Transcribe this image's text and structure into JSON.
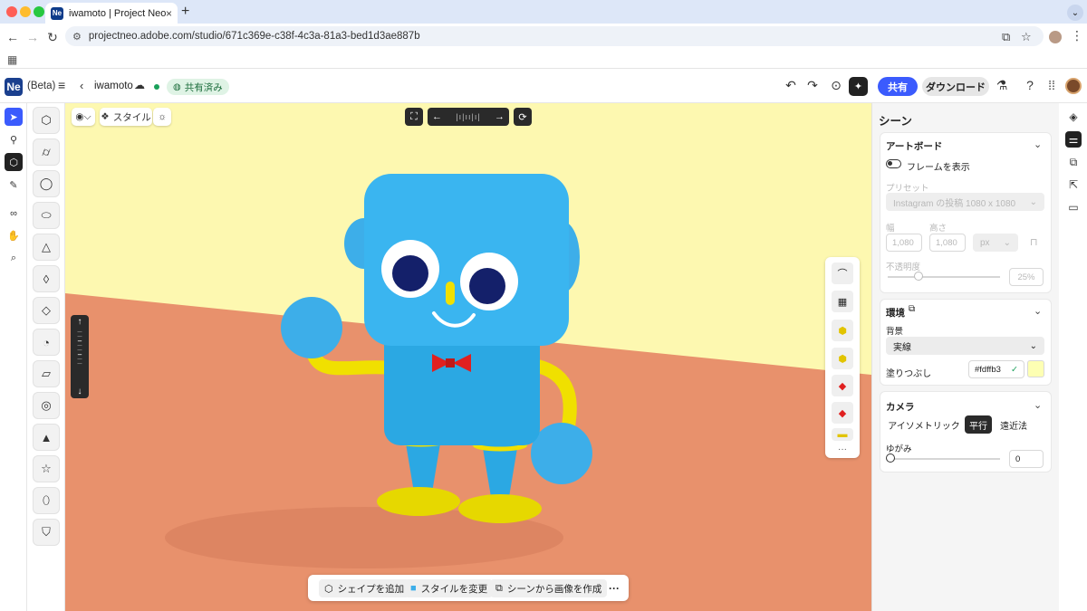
{
  "browser": {
    "tab_title": "iwamoto | Project Neo (Beta)",
    "tab_favicon": "Ne",
    "tab_close": "×",
    "new_tab": "+",
    "url": "projectneo.adobe.com/studio/671c369e-c38f-4c3a-81a3-bed1d3ae887b",
    "traffic_colors": [
      "#ff5f57",
      "#febc2e",
      "#28c840"
    ]
  },
  "app": {
    "logo": "Ne",
    "beta": "(Beta)",
    "doc_name": "iwamoto",
    "shared_label": "共有済み",
    "share_button": "共有",
    "download_button": "ダウンロード",
    "accent": "#3b5bfd"
  },
  "canvas": {
    "camera_chip": "⌵",
    "style_chip": "スタイル",
    "bottom_toolbar": {
      "add_shape": "シェイプを追加",
      "change_style": "スタイルを変更",
      "create_image": "シーンから画像を作成",
      "more": "···"
    },
    "bg_color": "#fdf8b0",
    "floor_color": "#e8916c"
  },
  "panel": {
    "title": "シーン",
    "artboard": {
      "title": "アートボード",
      "show_frame": "フレームを表示",
      "preset_label": "プリセット",
      "preset_value": "Instagram の投稿 1080 x 1080",
      "width_label": "幅",
      "height_label": "高さ",
      "width_value": "1,080",
      "height_value": "1,080",
      "unit": "px",
      "opacity_label": "不透明度",
      "opacity_value": "25%",
      "opacity_fraction": 0.25
    },
    "environment": {
      "title": "環境",
      "bg_label": "背景",
      "bg_value": "実線",
      "fill_label": "塗りつぶし",
      "fill_hex": "#fdffb3",
      "fill_check": "✓"
    },
    "camera": {
      "title": "カメラ",
      "modes": [
        "アイソメトリック",
        "平行",
        "遠近法"
      ],
      "active_mode": "平行",
      "distortion_label": "ゆがみ",
      "distortion_value": "0"
    }
  }
}
